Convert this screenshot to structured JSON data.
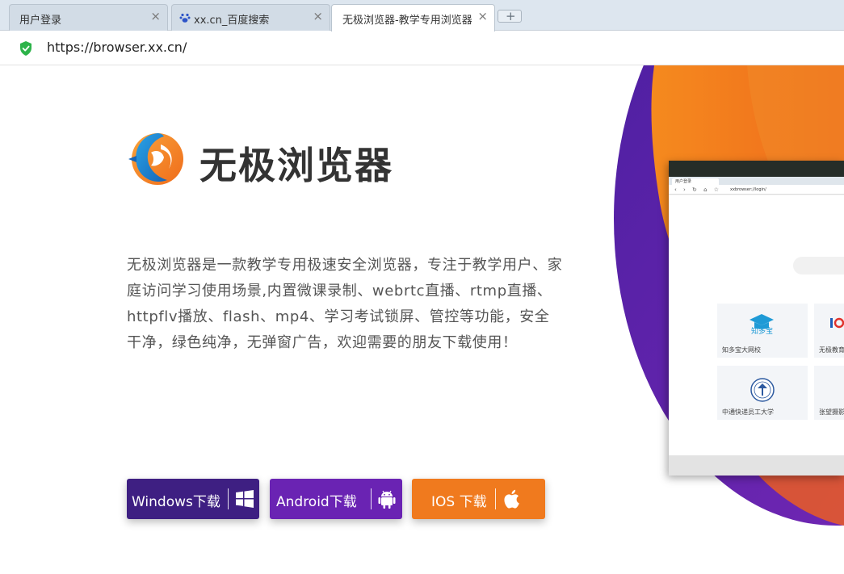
{
  "tabs": [
    {
      "label": "用户登录",
      "close": "×"
    },
    {
      "label": "xx.cn_百度搜索",
      "close": "×"
    },
    {
      "label": "无极浏览器-教学专用浏览器",
      "close": "×"
    }
  ],
  "address": {
    "url": "https://browser.xx.cn/"
  },
  "brand": {
    "name": "无极浏览器"
  },
  "description": "无极浏览器是一款教学专用极速安全浏览器，专注于教学用户、家庭访问学习使用场景,内置微课录制、webrtc直播、rtmp直播、httpflv播放、flash、mp4、学习考试锁屏、管控等功能，安全干净，绿色纯净，无弹窗广告，欢迎需要的朋友下载使用！",
  "downloads": [
    {
      "label": "Windows下载",
      "icon": "windows-icon",
      "color": "#3e1f82"
    },
    {
      "label": "Android下载",
      "icon": "android-icon",
      "color": "#6a23b3"
    },
    {
      "label": "IOS 下载",
      "icon": "apple-icon",
      "color": "#f07a1e"
    }
  ],
  "preview": {
    "tab_label": "用户登录",
    "url": "xxbrowser://login/",
    "cards": [
      {
        "label": "知多宝大网校",
        "logo_text": "知多宝"
      },
      {
        "label": "无极教育"
      },
      {
        "label": "中通快递员工大学"
      },
      {
        "label": "张望摄影"
      }
    ]
  },
  "colors": {
    "orange": "#f07a1e",
    "purple": "#6a23b3",
    "deep_purple": "#3e1f82",
    "secure_green": "#2db34a"
  }
}
